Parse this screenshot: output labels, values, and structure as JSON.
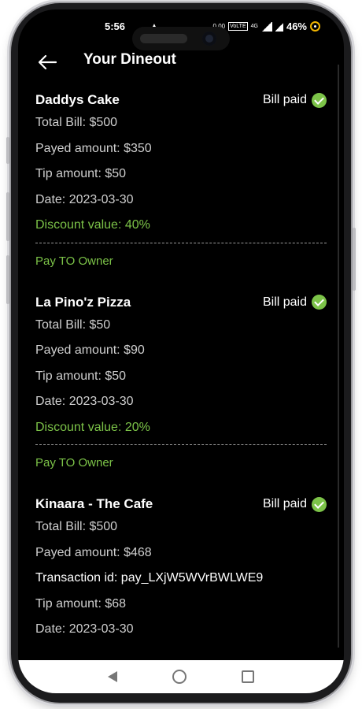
{
  "status_bar": {
    "time": "5:56",
    "notif": "▲",
    "net_speed": "0.00",
    "volte": "VoLTE",
    "network": "4G",
    "battery": "46%"
  },
  "header": {
    "title": "Your Dineout",
    "back_icon": "arrow-left-icon"
  },
  "colors": {
    "accent_green": "#7cc348",
    "background": "#000000"
  },
  "dineouts": [
    {
      "name": "Daddys Cake",
      "status": "Bill paid",
      "total_bill": "Total Bill: $500",
      "payed_amount": "Payed amount: $350",
      "tip_amount": "Tip amount: $50",
      "date": "Date: 2023-03-30",
      "discount": "Discount value: 40%",
      "pay_link": "Pay TO Owner"
    },
    {
      "name": "La Pino'z Pizza",
      "status": "Bill paid",
      "total_bill": "Total Bill: $50",
      "payed_amount": "Payed amount: $90",
      "tip_amount": "Tip amount: $50",
      "date": "Date: 2023-03-30",
      "discount": "Discount value: 20%",
      "pay_link": "Pay TO Owner"
    },
    {
      "name": "Kinaara - The Cafe",
      "status": "Bill paid",
      "total_bill": "Total Bill: $500",
      "payed_amount": "Payed amount: $468",
      "transaction": "Transaction id: pay_LXjW5WVrBWLWE9",
      "tip_amount": "Tip amount: $68",
      "date": "Date: 2023-03-30"
    }
  ]
}
